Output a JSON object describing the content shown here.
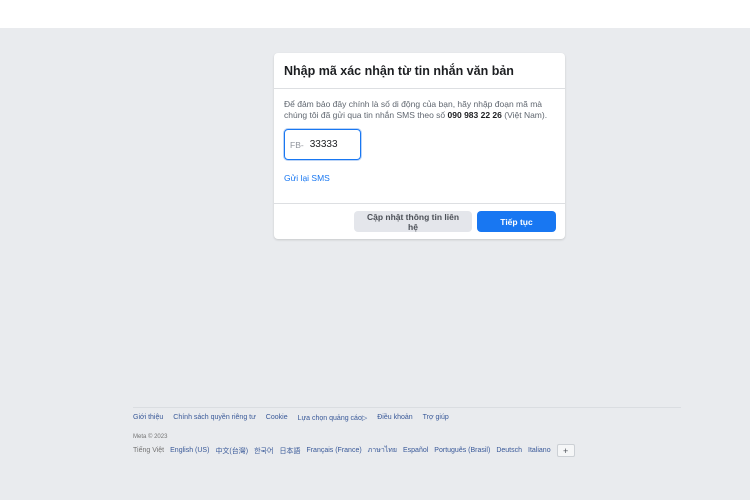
{
  "card": {
    "title": "Nhập mã xác nhận từ tin nhắn văn bản",
    "description_pre": "Để đảm bảo đây chính là số di động của bạn, hãy nhập đoạn mã mà chúng tôi đã gửi qua tin nhắn SMS theo số ",
    "phone": "090 983 22 26",
    "description_post": " (Việt Nam).",
    "code_prefix": "FB-",
    "code_value": "33333",
    "resend_label": "Gửi lại SMS",
    "update_button": "Cập nhật thông tin liên hệ",
    "continue_button": "Tiếp tục"
  },
  "footer": {
    "links": [
      "Giới thiệu",
      "Chính sách quyền riêng tư",
      "Cookie",
      "Lựa chọn quảng cáo",
      "Điều khoản",
      "Trợ giúp"
    ],
    "copyright": "Meta © 2023",
    "current_language": "Tiếng Việt",
    "languages": [
      "English (US)",
      "中文(台灣)",
      "한국어",
      "日本語",
      "Français (France)",
      "ภาษาไทย",
      "Español",
      "Português (Brasil)",
      "Deutsch",
      "Italiano"
    ],
    "add_language": "+"
  }
}
